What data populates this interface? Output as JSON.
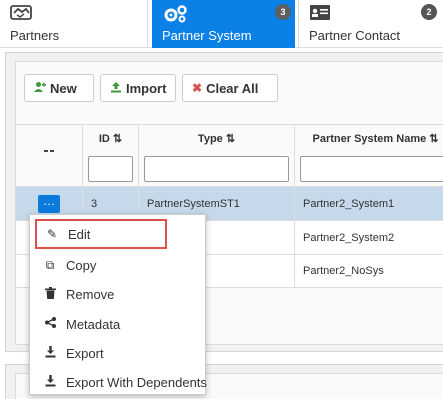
{
  "tabs": [
    {
      "label": "Partners",
      "icon": "handshake-icon",
      "badge": ""
    },
    {
      "label": "Partner System",
      "icon": "gears-icon",
      "badge": "3"
    },
    {
      "label": "Partner Contact",
      "icon": "contact-card-icon",
      "badge": "2"
    }
  ],
  "toolbar": {
    "new_label": "New",
    "import_label": "Import",
    "clear_label": "Clear All"
  },
  "grid": {
    "headers": {
      "id": "ID ⇅",
      "type": "Type ⇅",
      "name": "Partner System Name ⇅"
    },
    "rows": [
      {
        "id": "3",
        "type": "PartnerSystemST1",
        "name": "Partner2_System1"
      },
      {
        "id": "",
        "type": "emST2",
        "name": "Partner2_System2"
      },
      {
        "id": "",
        "type": "emST2",
        "name": "Partner2_NoSys"
      }
    ]
  },
  "menu": {
    "items": [
      {
        "label": "Edit",
        "icon": "pencil-icon"
      },
      {
        "label": "Copy",
        "icon": "copy-icon"
      },
      {
        "label": "Remove",
        "icon": "trash-icon"
      },
      {
        "label": "Metadata",
        "icon": "share-icon"
      },
      {
        "label": "Export",
        "icon": "download-icon"
      },
      {
        "label": "Export With Dependents",
        "icon": "download-icon"
      }
    ]
  },
  "colors": {
    "accent": "#0b80e6",
    "selected_row": "#c5d9ea",
    "highlight_border": "#d9534f",
    "new_icon": "#3a9a3a",
    "import_icon": "#3a9a3a",
    "clear_icon": "#d9534f"
  }
}
